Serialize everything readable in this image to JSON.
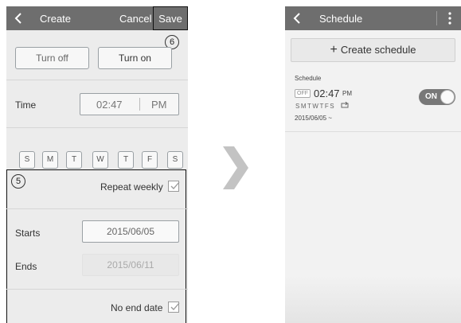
{
  "create_screen": {
    "title": "Create",
    "cancel": "Cancel",
    "save": "Save",
    "callout_save": "6",
    "callout_repeat": "5",
    "turn_off": "Turn off",
    "turn_on": "Turn on",
    "time_label": "Time",
    "time_value": "02:47",
    "time_ampm": "PM",
    "days": [
      "S",
      "M",
      "T",
      "W",
      "T",
      "F",
      "S"
    ],
    "repeat_weekly": "Repeat weekly",
    "repeat_weekly_checked": true,
    "starts_label": "Starts",
    "starts_value": "2015/06/05",
    "ends_label": "Ends",
    "ends_value": "2015/06/11",
    "no_end_date": "No end date",
    "no_end_date_checked": true
  },
  "schedule_screen": {
    "title": "Schedule",
    "create_button": "Create schedule",
    "section_label": "Schedule",
    "item": {
      "action_badge": "OFF",
      "time": "02:47",
      "ampm": "PM",
      "days": "SMTWTFS",
      "date": "2015/06/05 ~",
      "toggle_label": "ON"
    }
  },
  "colors": {
    "topbar": "#6e6e6e",
    "screen_bg": "#ececec",
    "toggle_bg": "#787878"
  }
}
